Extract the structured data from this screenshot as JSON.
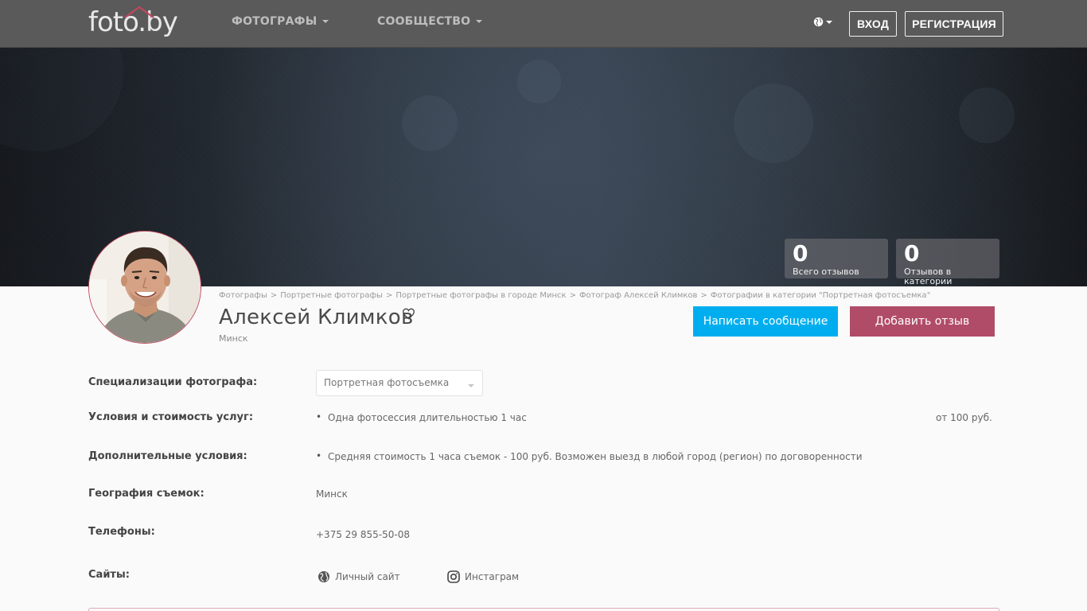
{
  "header": {
    "logo": "foto.by",
    "nav": [
      {
        "label": "ФОТОГРАФЫ"
      },
      {
        "label": "СООБЩЕСТВО"
      }
    ],
    "login_label": "ВХОД",
    "register_label": "РЕГИСТРАЦИЯ"
  },
  "stats": [
    {
      "value": "0",
      "label": "Всего отзывов"
    },
    {
      "value": "0",
      "label": "Отзывов в категории"
    }
  ],
  "breadcrumb": [
    "Фотографы",
    "Портретные фотографы",
    "Портретные фотографы в городе Минск",
    "Фотограф Алексей Климков",
    "Фотографии в категории \"Портретная фотосъемка\""
  ],
  "profile": {
    "name": "Алексей Климков",
    "city": "Минск",
    "message_button": "Написать сообщение",
    "review_button": "Добавить отзыв"
  },
  "details": {
    "specialization_label": "Специализации фотографа:",
    "specialization_value": "Портретная фотосъемка",
    "conditions_label": "Условия и стоимость услуг:",
    "conditions_item": "Одна фотосессия длительностью 1 час",
    "conditions_price": "от 100 руб.",
    "extra_label": "Дополнительные условия:",
    "extra_item": "Средняя стоимость 1 часа съемок - 100 руб. Возможен выезд в любой город (регион) по договоренности",
    "geo_label": "География съемок:",
    "geo_value": "Минск",
    "phones_label": "Телефоны:",
    "phone": "+375 29 855-50-08",
    "sites_label": "Сайты:",
    "site_personal": "Личный сайт",
    "site_instagram": "Инстаграм"
  },
  "colors": {
    "header_bg": "#5a5a5a",
    "message_button": "#00aeef",
    "review_button": "#b14c68",
    "avatar_border": "#c0485f"
  }
}
